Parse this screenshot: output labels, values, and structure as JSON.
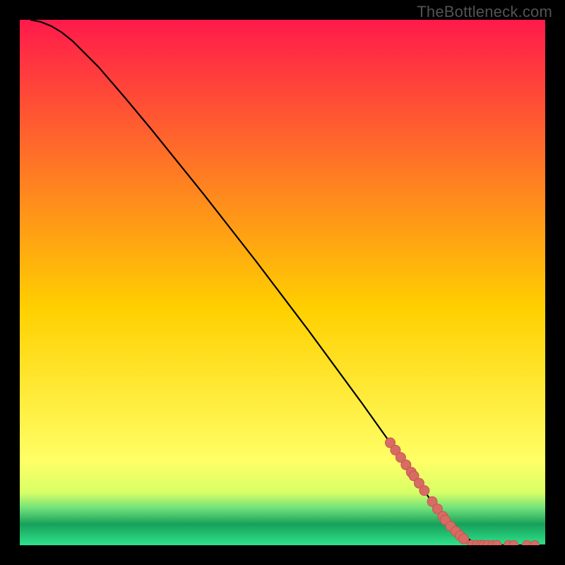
{
  "watermark": "TheBottleneck.com",
  "colors": {
    "gradient_top": "#ff1a4b",
    "gradient_mid": "#ffd000",
    "gradient_green_top": "#d8ff66",
    "gradient_green_dark": "#17a05a",
    "gradient_green_end": "#2fe38b",
    "curve": "#000000",
    "marker_fill": "#d86b64",
    "marker_stroke": "#c25750"
  },
  "chart_data": {
    "type": "line",
    "title": "",
    "xlabel": "",
    "ylabel": "",
    "xlim": [
      0,
      100
    ],
    "ylim": [
      0,
      100
    ],
    "curve": {
      "x": [
        2,
        4,
        6,
        8,
        10,
        15,
        20,
        25,
        30,
        35,
        40,
        45,
        50,
        55,
        60,
        65,
        70,
        75,
        80,
        82,
        84,
        86,
        88,
        90,
        92,
        94,
        96,
        98,
        100
      ],
      "y": [
        100,
        99.6,
        98.8,
        97.6,
        96.0,
        91.0,
        85.2,
        79.2,
        73.0,
        66.8,
        60.4,
        54.0,
        47.4,
        40.8,
        34.0,
        27.2,
        20.2,
        13.2,
        6.0,
        3.8,
        2.0,
        0.8,
        0.2,
        0.05,
        0.02,
        0.01,
        0.0,
        0.0,
        0.0
      ]
    },
    "markers_on_slope": {
      "x": [
        70.5,
        71.5,
        72.5,
        73.5,
        74.5,
        75.0,
        76.0,
        77.0,
        78.5,
        79.5,
        80.5,
        81.0,
        82.0,
        83.0,
        83.8,
        84.5
      ],
      "y": [
        19.5,
        18.1,
        16.7,
        15.3,
        13.9,
        13.2,
        11.8,
        10.4,
        8.3,
        6.9,
        5.5,
        4.8,
        3.6,
        2.6,
        1.8,
        1.2
      ]
    },
    "markers_on_floor": {
      "x": [
        86.0,
        87.0,
        87.8,
        88.3,
        89.0,
        90.0,
        90.8,
        93.0,
        94.0,
        96.5,
        98.0
      ],
      "y": [
        0.1,
        0.07,
        0.06,
        0.05,
        0.04,
        0.035,
        0.03,
        0.02,
        0.018,
        0.01,
        0.008
      ]
    }
  }
}
